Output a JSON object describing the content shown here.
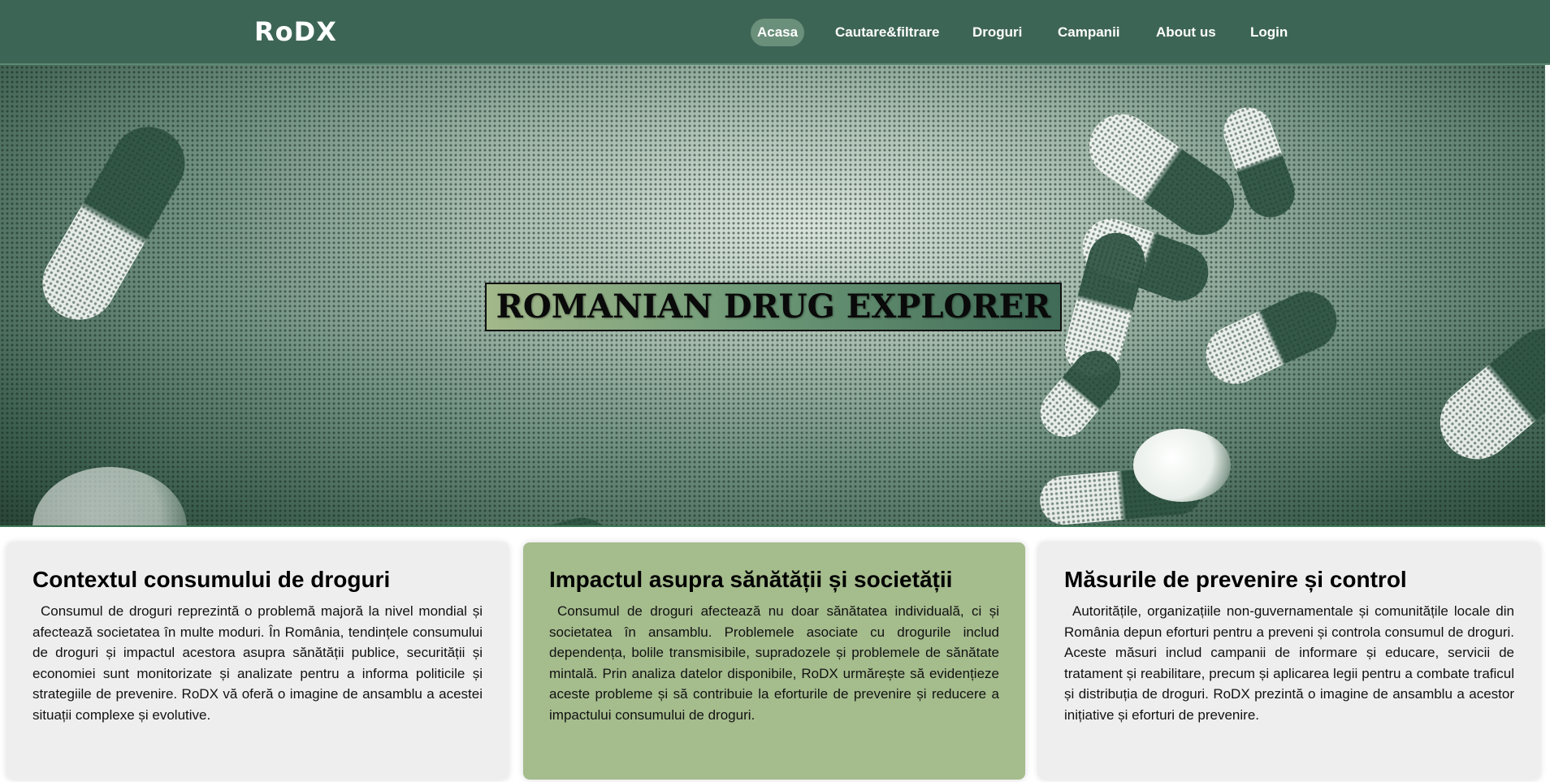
{
  "header": {
    "brand": "RoDX",
    "nav": [
      {
        "label": "Acasa",
        "active": true
      },
      {
        "label": "Cautare&filtrare",
        "active": false
      },
      {
        "label": "Droguri",
        "active": false
      },
      {
        "label": "Campanii",
        "active": false
      },
      {
        "label": "About us",
        "active": false
      },
      {
        "label": "Login",
        "active": false
      }
    ]
  },
  "hero": {
    "title": "ROMANIAN DRUG EXPLORER"
  },
  "cards": [
    {
      "title": "Contextul consumului de droguri",
      "text": "Consumul de droguri reprezintă o problemă majoră la nivel mondial și afectează societatea în multe moduri. În România, tendințele consumului de droguri și impactul acestora asupra sănătății publice, securității și economiei sunt monitorizate și analizate pentru a informa politicile și strategiile de prevenire. RoDX vă oferă o imagine de ansamblu a acestei situații complexe și evolutive."
    },
    {
      "title": "Impactul asupra sănătății și societății",
      "text": "Consumul de droguri afectează nu doar sănătatea individuală, ci și societatea în ansamblu. Problemele asociate cu drogurile includ dependența, bolile transmisibile, supradozele și problemele de sănătate mintală. Prin analiza datelor disponibile, RoDX urmărește să evidențieze aceste probleme și să contribuie la eforturile de prevenire și reducere a impactului consumului de droguri."
    },
    {
      "title": "Măsurile de prevenire și control",
      "text": "Autoritățile, organizațiile non-guvernamentale și comunitățile locale din România depun eforturi pentru a preveni și controla consumul de droguri. Aceste măsuri includ campanii de informare și educare, servicii de tratament și reabilitare, precum și aplicarea legii pentru a combate traficul și distribuția de droguri. RoDX prezintă o imagine de ansamblu a acestor inițiative și eforturi de prevenire."
    }
  ],
  "colors": {
    "header_bg": "#3d6556",
    "active_nav_bg": "#6a8f7a",
    "card_grey": "#eeeeee",
    "card_green": "#a5bc8d"
  }
}
